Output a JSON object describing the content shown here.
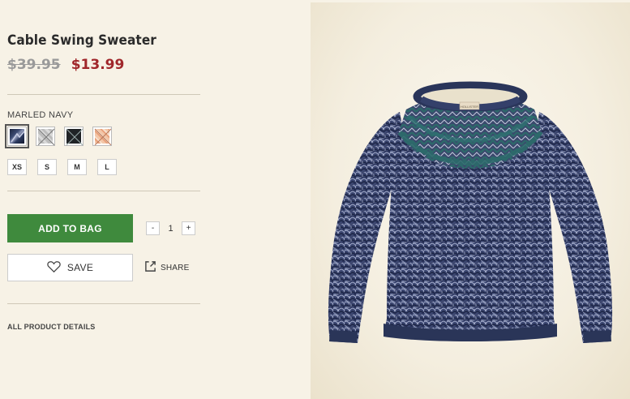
{
  "product": {
    "title": "Cable Swing Sweater",
    "price_original": "$39.95",
    "price_sale": "$13.99",
    "color_label": "MARLED NAVY",
    "swatches": [
      {
        "name": "marled-navy",
        "selected": true
      },
      {
        "name": "grey",
        "selected": false
      },
      {
        "name": "black",
        "selected": false
      },
      {
        "name": "peach",
        "selected": false
      }
    ],
    "sizes": [
      "XS",
      "S",
      "M",
      "L"
    ],
    "quantity": {
      "minus": "-",
      "value": "1",
      "plus": "+"
    },
    "add_to_bag": "ADD TO BAG",
    "save": "SAVE",
    "share": "SHARE",
    "all_details": "ALL PRODUCT DETAILS",
    "image_label": "HOLLISTER"
  },
  "colors": {
    "sale_price": "#a0272b",
    "add_button": "#3f8a3d",
    "navy": "#2b3a5c",
    "teal": "#2c6a6a"
  },
  "icons": [
    "heart-icon",
    "share-icon"
  ]
}
